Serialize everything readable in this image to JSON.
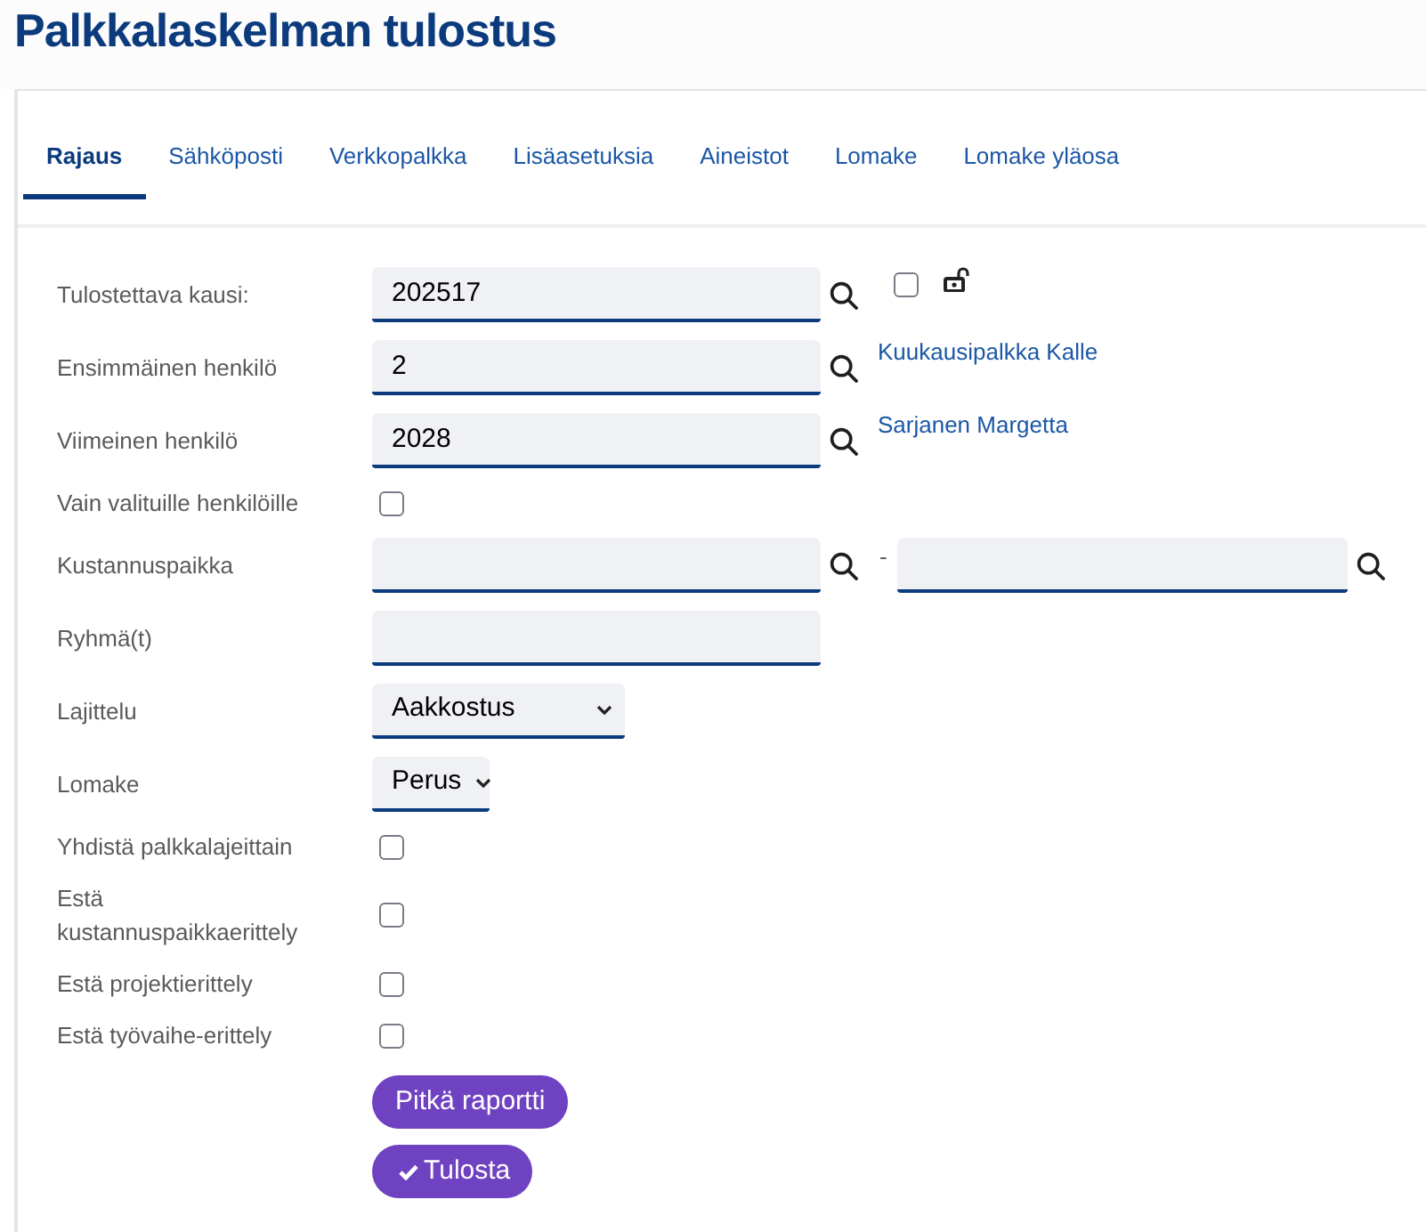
{
  "page": {
    "title": "Palkkalaskelman tulostus"
  },
  "tabs": [
    {
      "label": "Rajaus",
      "selected": true
    },
    {
      "label": "Sähköposti",
      "selected": false
    },
    {
      "label": "Verkkopalkka",
      "selected": false
    },
    {
      "label": "Lisäasetuksia",
      "selected": false
    },
    {
      "label": "Aineistot",
      "selected": false
    },
    {
      "label": "Lomake",
      "selected": false
    },
    {
      "label": "Lomake yläosa",
      "selected": false
    }
  ],
  "form": {
    "rows": [
      {
        "kind": "lookup",
        "label": "Tulostettava kausi:",
        "value": "202517",
        "period_checkbox": {
          "checked": false
        },
        "lock": {
          "locked": false
        }
      },
      {
        "kind": "lookup",
        "label": "Ensimmäinen henkilö",
        "value": "2",
        "name": "Kuukausipalkka Kalle"
      },
      {
        "kind": "lookup",
        "label": "Viimeinen henkilö",
        "value": "2028",
        "name": "Sarjanen Margetta"
      },
      {
        "kind": "checkbox",
        "label": "Vain valituille henkilöille",
        "checked": false
      },
      {
        "kind": "range",
        "label": "Kustannuspaikka",
        "separator": "-"
      },
      {
        "kind": "text",
        "label": "Ryhmä(t)"
      },
      {
        "kind": "select",
        "label": "Lajittelu",
        "value": "Aakkostus"
      },
      {
        "kind": "select",
        "label": "Lomake",
        "value": "Perus"
      },
      {
        "kind": "checkbox",
        "label": "Yhdistä palkkalajeittain",
        "checked": false
      },
      {
        "kind": "checkbox",
        "label": "Estä kustannuspaikkaerittely",
        "checked": false
      },
      {
        "kind": "checkbox",
        "label": "Estä projektierittely",
        "checked": false
      },
      {
        "kind": "checkbox",
        "label": "Estä työvaihe-erittely",
        "checked": false
      }
    ]
  },
  "buttons": [
    {
      "kind": "plain",
      "label": "Pitkä raportti"
    },
    {
      "kind": "confirm",
      "label": "Tulosta"
    }
  ]
}
